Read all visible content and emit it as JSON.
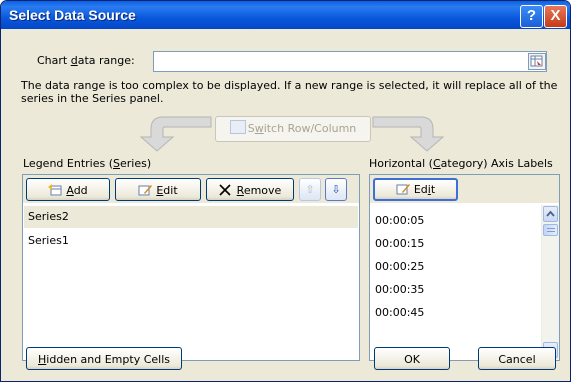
{
  "window": {
    "title": "Select Data Source",
    "help_glyph": "?",
    "close_glyph": "X"
  },
  "chart_range": {
    "label_pre": "Chart ",
    "label_u": "d",
    "label_post": "ata range:",
    "value": ""
  },
  "message": "The data range is too complex to be displayed. If a new range is selected, it will replace all of the series in the Series panel.",
  "switch_button": {
    "label_pre": "S",
    "label_u": "w",
    "label_post": "itch Row/Column"
  },
  "legend_entries": {
    "heading_pre": "Legend Entries (",
    "heading_u": "S",
    "heading_post": "eries)",
    "add_pre": "",
    "add_u": "A",
    "add_post": "dd",
    "edit_pre": "",
    "edit_u": "E",
    "edit_post": "dit",
    "remove_pre": "",
    "remove_u": "R",
    "remove_post": "emove",
    "up_glyph": "⇧",
    "down_glyph": "⇩",
    "series": [
      "Series2",
      "Series1"
    ]
  },
  "axis_labels": {
    "heading_pre": "Horizontal (",
    "heading_u": "C",
    "heading_post": "ategory) Axis Labels",
    "edit_pre": "Ed",
    "edit_u": "i",
    "edit_post": "t",
    "items": [
      "00:00:05",
      "00:00:15",
      "00:00:25",
      "00:00:35",
      "00:00:45"
    ]
  },
  "footer": {
    "hidden_pre": "",
    "hidden_u": "H",
    "hidden_post": "idden and Empty Cells",
    "ok_label": "OK",
    "cancel_label": "Cancel"
  },
  "colors": {
    "titlebar": "#0a58dc",
    "dialog_bg": "#ece9d8",
    "panel_border": "#7f9db9",
    "button_border": "#003c74"
  }
}
